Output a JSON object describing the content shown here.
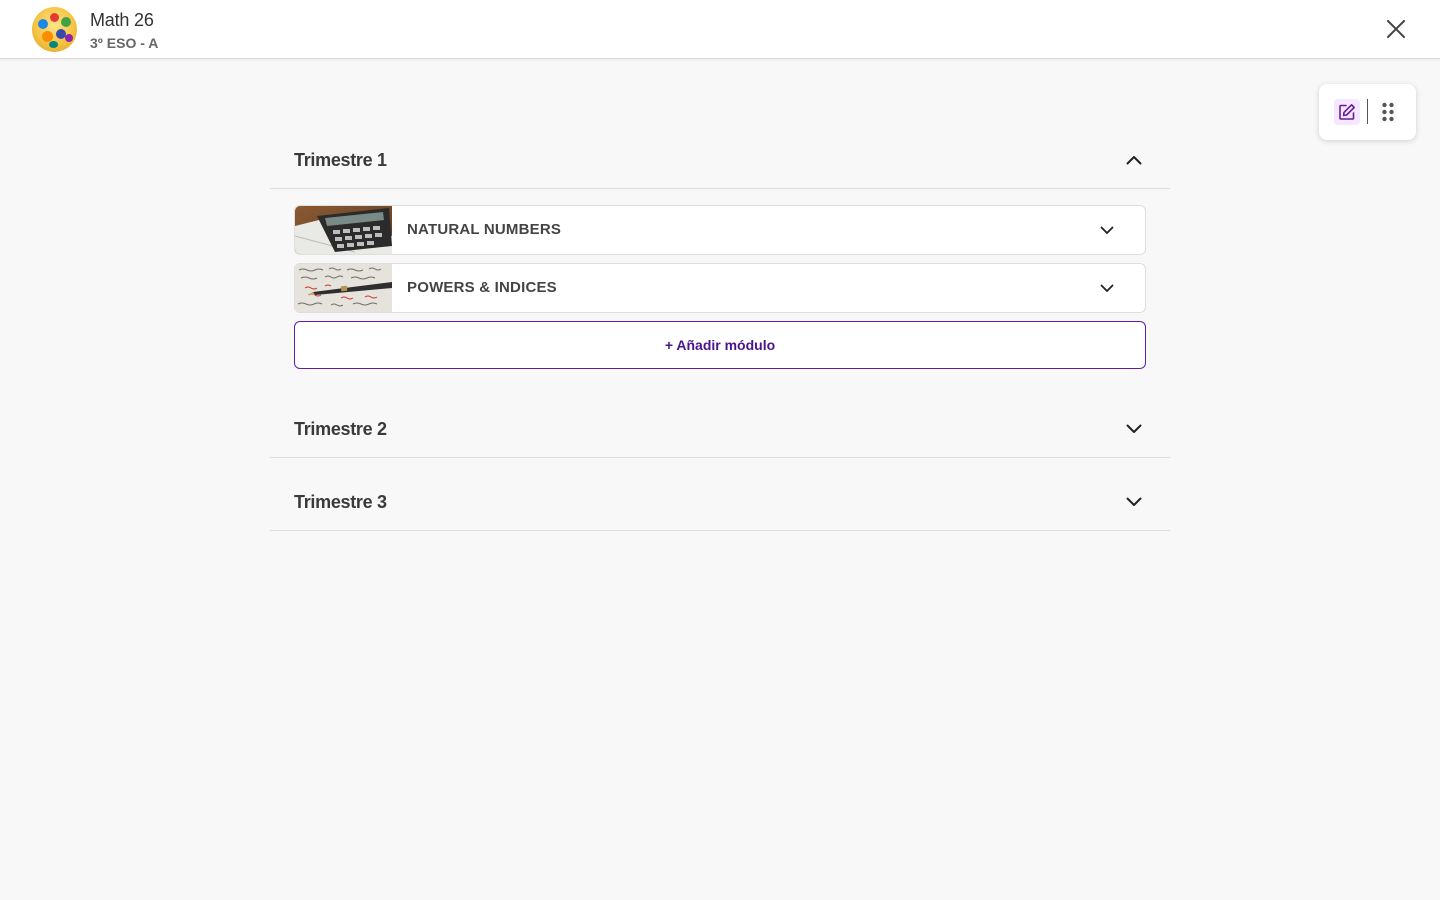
{
  "header": {
    "course_title": "Math 26",
    "course_subtitle": "3º ESO - A",
    "close_icon": "close-icon"
  },
  "toolbar": {
    "edit_icon": "edit-icon",
    "grip_icon": "grip-icon"
  },
  "sections": [
    {
      "title": "Trimestre 1",
      "expanded": true,
      "modules": [
        {
          "label": "NATURAL NUMBERS",
          "thumbnail": "calculator-image"
        },
        {
          "label": "POWERS & INDICES",
          "thumbnail": "handwritten-notes-image"
        }
      ],
      "add_module_label": "+ Añadir módulo"
    },
    {
      "title": "Trimestre 2",
      "expanded": false
    },
    {
      "title": "Trimestre 3",
      "expanded": false
    }
  ],
  "colors": {
    "accent": "#5b1fa6",
    "accent_text": "#4a148c",
    "edit_bg": "#f3e8ff",
    "background": "#f8f8f8"
  }
}
